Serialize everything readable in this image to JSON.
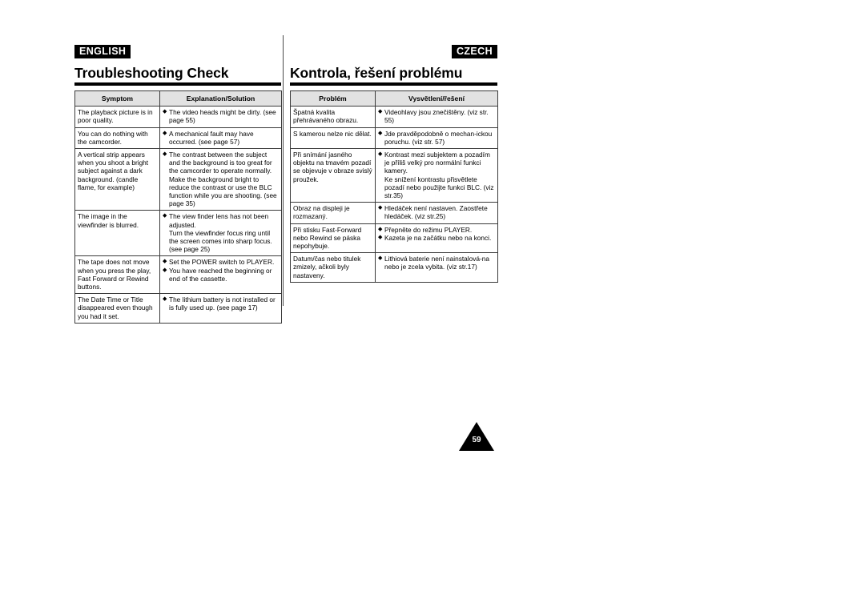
{
  "page": {
    "number": "59"
  },
  "left_section": {
    "language_badge": "ENGLISH",
    "title": "Troubleshooting Check",
    "table": {
      "headers": [
        "Symptom",
        "Explanation/Solution"
      ],
      "rows": [
        {
          "symptom": "The playback picture is in poor quality.",
          "solutions": [
            "The video heads might be dirty. (see page 55)"
          ]
        },
        {
          "symptom": "You can do nothing with the camcorder.",
          "solutions": [
            "A mechanical fault may have occurred. (see page 57)"
          ]
        },
        {
          "symptom": "A vertical strip appears when you shoot a bright subject against a dark background. (candle flame, for example)",
          "solutions": [
            "The contrast between the subject and the background is too great for the camcorder to operate normally. Make the background bright to reduce the contrast or use the BLC function while you are shooting. (see page 35)"
          ]
        },
        {
          "symptom": "The image in the viewfinder is blurred.",
          "solutions": [
            "The view finder lens has not been adjusted.\nTurn the viewfinder focus ring until the screen comes into sharp focus. (see page 25)"
          ]
        },
        {
          "symptom": "The tape does not move when you press the play, Fast Forward or Rewind buttons.",
          "solutions": [
            "Set the POWER switch to PLAYER.",
            "You have reached the beginning or end of the cassette."
          ]
        },
        {
          "symptom": "The Date Time or Title disappeared even though you had it set.",
          "solutions": [
            "The lithium battery is not installed or is fully used up. (see page 17)"
          ]
        }
      ]
    }
  },
  "right_section": {
    "language_badge": "CZECH",
    "title": "Kontrola, řešení problému",
    "table": {
      "headers": [
        "Problém",
        "Vysvětlení/řešení"
      ],
      "rows": [
        {
          "symptom": "Špatná kvalita přehrávaného obrazu.",
          "solutions": [
            "Videohlavy jsou znečištěny. (viz str. 55)"
          ]
        },
        {
          "symptom": "S kamerou nelze nic dělat.",
          "solutions": [
            "Jde pravděpodobně o mechan-ickou poruchu. (viz str. 57)"
          ]
        },
        {
          "symptom": "Při snímání jasného objektu na tmavém pozadí se objevuje v obraze svislý proužek.",
          "solutions": [
            "Kontrast mezi subjektem a pozadím je příliš velký pro normální funkci kamery.\nKe snížení kontrastu přisvětlete pozadí nebo použijte funkci BLC. (viz str.35)"
          ]
        },
        {
          "symptom": "Obraz na displeji je rozmazaný.",
          "solutions": [
            "Hledáček není nastaven. Zaostřete hledáček. (viz str.25)"
          ]
        },
        {
          "symptom": "Při stisku Fast-Forward nebo Rewind se páska nepohybuje.",
          "solutions": [
            "Přepněte do režimu PLAYER.",
            "Kazeta je na začátku nebo na konci."
          ]
        },
        {
          "symptom": "Datum/čas nebo titulek zmizely, ačkoli byly nastaveny.",
          "solutions": [
            "Lithiová baterie není nainstalová-na nebo je zcela vybita. (viz str.17)"
          ]
        }
      ]
    }
  },
  "icons": {
    "bullet": "diamond-bullet-icon"
  }
}
